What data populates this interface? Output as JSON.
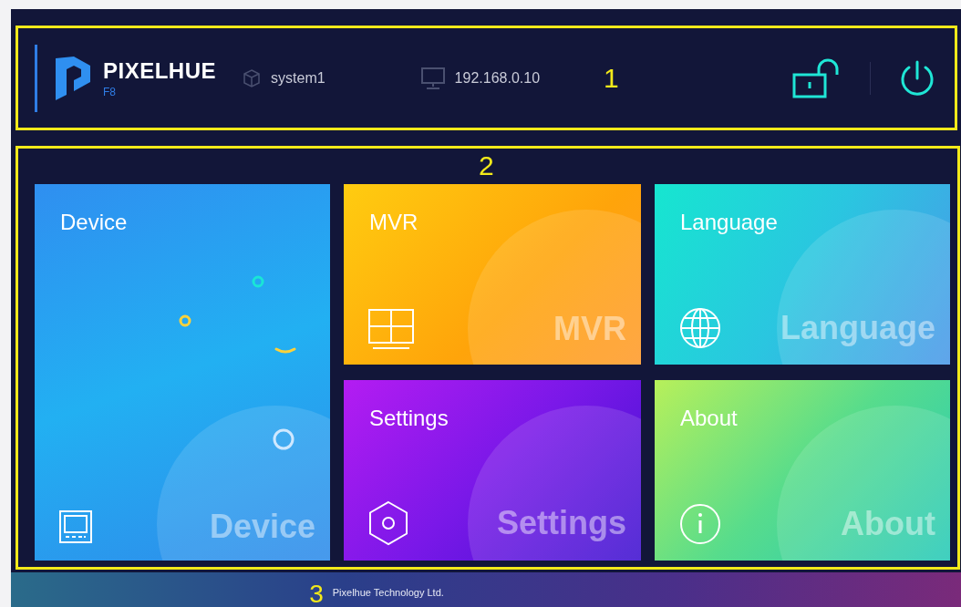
{
  "header": {
    "annotation": "1",
    "brand": "PIXELHUE",
    "model": "F8",
    "system_name": "system1",
    "ip_address": "192.168.0.10",
    "locked": false
  },
  "main": {
    "annotation": "2",
    "tiles": [
      {
        "kind": "device",
        "title": "Device",
        "watermark": "Device"
      },
      {
        "kind": "mvr",
        "title": "MVR",
        "watermark": "MVR"
      },
      {
        "kind": "language",
        "title": "Language",
        "watermark": "Language"
      },
      {
        "kind": "settings",
        "title": "Settings",
        "watermark": "Settings"
      },
      {
        "kind": "about",
        "title": "About",
        "watermark": "About"
      }
    ]
  },
  "footer": {
    "annotation": "3",
    "company": "Pixelhue Technology Ltd."
  }
}
